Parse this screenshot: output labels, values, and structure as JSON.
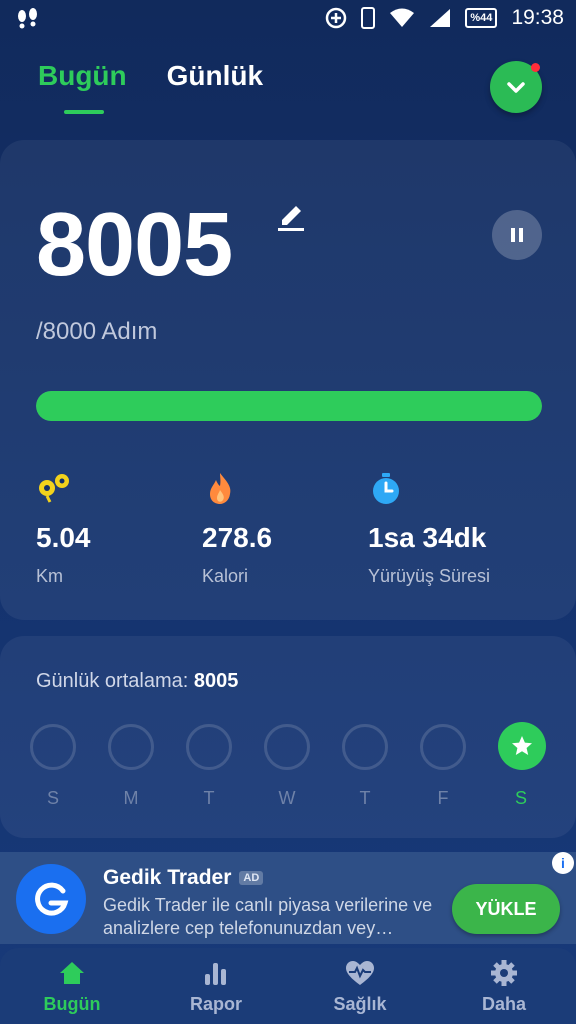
{
  "status_bar": {
    "time": "19:38",
    "battery": "%44"
  },
  "tabs": {
    "today": "Bugün",
    "daily": "Günlük"
  },
  "today": {
    "steps": "8005",
    "goal_text": "/8000 Adım",
    "progress_fraction": 1.0,
    "stats": [
      {
        "icon": "distance-icon",
        "value": "5.04",
        "label": "Km"
      },
      {
        "icon": "flame-icon",
        "value": "278.6",
        "label": "Kalori"
      },
      {
        "icon": "stopwatch-icon",
        "value": "1sa 34dk",
        "label": "Yürüyüş Süresi"
      }
    ]
  },
  "weekly": {
    "avg_label": "Günlük ortalama:",
    "avg_value": "8005",
    "days": [
      {
        "label": "S",
        "done": false
      },
      {
        "label": "M",
        "done": false
      },
      {
        "label": "T",
        "done": false
      },
      {
        "label": "W",
        "done": false
      },
      {
        "label": "T",
        "done": false
      },
      {
        "label": "F",
        "done": false
      },
      {
        "label": "S",
        "done": true
      }
    ]
  },
  "ad": {
    "title": "Gedik Trader",
    "badge": "AD",
    "description": "Gedik Trader ile canlı piyasa verilerine ve analizlere cep telefonunuzdan vey…",
    "button": "YÜKLE"
  },
  "bottom_nav": [
    {
      "label": "Bugün",
      "icon": "home-icon",
      "active": true
    },
    {
      "label": "Rapor",
      "icon": "bar-chart-icon",
      "active": false
    },
    {
      "label": "Sağlık",
      "icon": "heart-pulse-icon",
      "active": false
    },
    {
      "label": "Daha",
      "icon": "gear-icon",
      "active": false
    }
  ],
  "colors": {
    "accent": "#2ecc5b",
    "background": "#13306a",
    "ad_button": "#3bb54a"
  }
}
